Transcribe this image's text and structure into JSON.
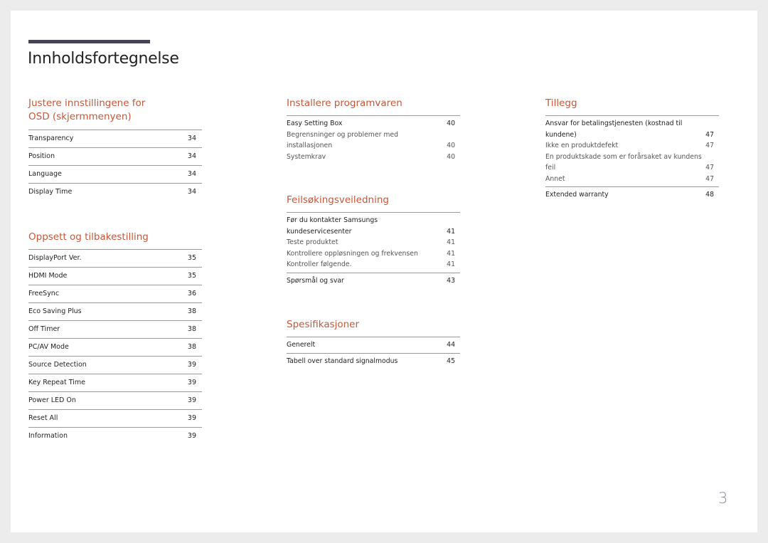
{
  "document": {
    "title": "Innholdsfortegnelse",
    "page_number": "3",
    "accent_color": "#c8573a"
  },
  "column1": {
    "sections": [
      {
        "title": "Justere innstillingene for OSD (skjermmenyen)",
        "items": [
          {
            "label": "Transparency",
            "page": "34"
          },
          {
            "label": "Position",
            "page": "34"
          },
          {
            "label": "Language",
            "page": "34"
          },
          {
            "label": "Display Time",
            "page": "34"
          }
        ]
      },
      {
        "title": "Oppsett og tilbakestilling",
        "items": [
          {
            "label": "DisplayPort Ver.",
            "page": "35"
          },
          {
            "label": "HDMI Mode",
            "page": "35"
          },
          {
            "label": "FreeSync",
            "page": "36"
          },
          {
            "label": "Eco Saving Plus",
            "page": "38"
          },
          {
            "label": "Off Timer",
            "page": "38"
          },
          {
            "label": "PC/AV Mode",
            "page": "38"
          },
          {
            "label": "Source Detection",
            "page": "39"
          },
          {
            "label": "Key Repeat Time",
            "page": "39"
          },
          {
            "label": "Power LED On",
            "page": "39"
          },
          {
            "label": "Reset All",
            "page": "39"
          },
          {
            "label": "Information",
            "page": "39"
          }
        ]
      }
    ]
  },
  "column2": {
    "sections": [
      {
        "title": "Installere programvaren",
        "groups": [
          {
            "head": {
              "label": "Easy Setting Box",
              "page": "40"
            },
            "subs": [
              {
                "label": "Begrensninger og problemer med installasjonen",
                "page": "40"
              },
              {
                "label": "Systemkrav",
                "page": "40"
              }
            ]
          }
        ]
      },
      {
        "title": "Feilsøkingsveiledning",
        "groups": [
          {
            "head": {
              "label": "Før du kontakter Samsungs kundeservicesenter",
              "page": "41"
            },
            "subs": [
              {
                "label": "Teste produktet",
                "page": "41"
              },
              {
                "label": "Kontrollere oppløsningen og frekvensen",
                "page": "41"
              },
              {
                "label": "Kontroller følgende.",
                "page": "41"
              }
            ]
          },
          {
            "head": {
              "label": "Spørsmål og svar",
              "page": "43"
            },
            "subs": []
          }
        ]
      },
      {
        "title": "Spesifikasjoner",
        "groups": [
          {
            "head": {
              "label": "Generelt",
              "page": "44"
            },
            "subs": []
          },
          {
            "head": {
              "label": "Tabell over standard signalmodus",
              "page": "45"
            },
            "subs": []
          }
        ]
      }
    ]
  },
  "column3": {
    "sections": [
      {
        "title": "Tillegg",
        "groups": [
          {
            "head": {
              "label": "Ansvar for betalingstjenesten (kostnad til kundene)",
              "page": "47"
            },
            "subs": [
              {
                "label": "Ikke en produktdefekt",
                "page": "47"
              },
              {
                "label": "En produktskade som er forårsaket av kundens feil",
                "page": "47"
              },
              {
                "label": "Annet",
                "page": "47"
              }
            ]
          },
          {
            "head": {
              "label": "Extended warranty",
              "page": "48"
            },
            "subs": []
          }
        ]
      }
    ]
  }
}
